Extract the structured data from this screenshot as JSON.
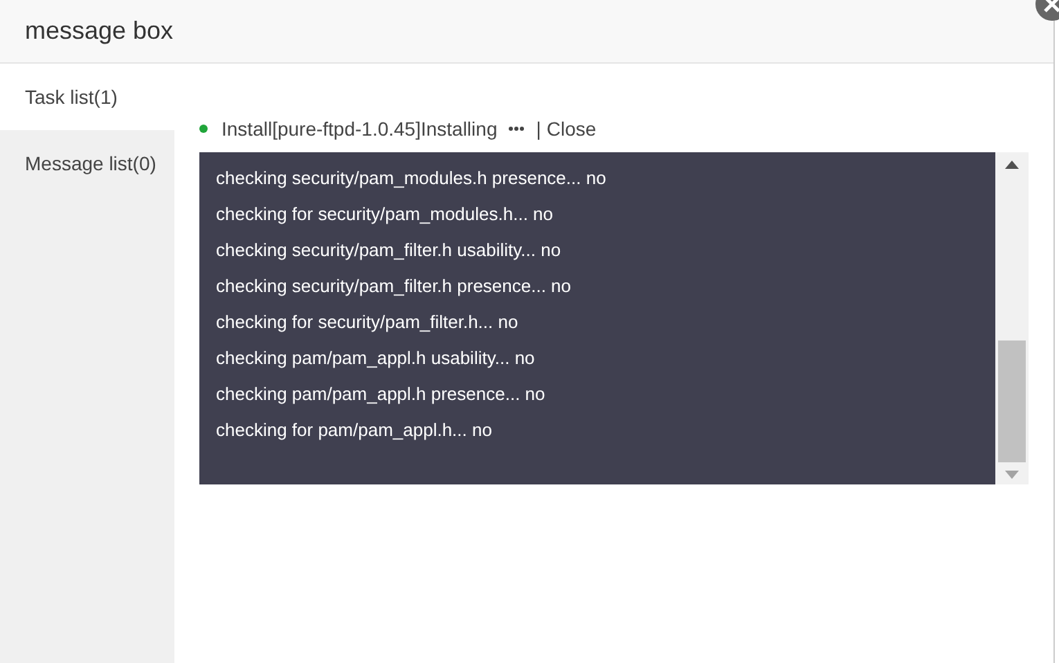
{
  "window": {
    "title": "message box"
  },
  "tabs": [
    {
      "label": "Task list(1)",
      "selected": true
    },
    {
      "label": "Message list(0)",
      "selected": false
    }
  ],
  "task": {
    "name": "Install[pure-ftpd-1.0.45]Installing",
    "separator": "|",
    "action": "Close"
  },
  "log": [
    "checking security/pam_modules.h presence... no",
    "checking for security/pam_modules.h... no",
    "checking security/pam_filter.h usability... no",
    "checking security/pam_filter.h presence... no",
    "checking for security/pam_filter.h... no",
    "checking pam/pam_appl.h usability... no",
    "checking pam/pam_appl.h presence... no",
    "checking for pam/pam_appl.h... no"
  ]
}
